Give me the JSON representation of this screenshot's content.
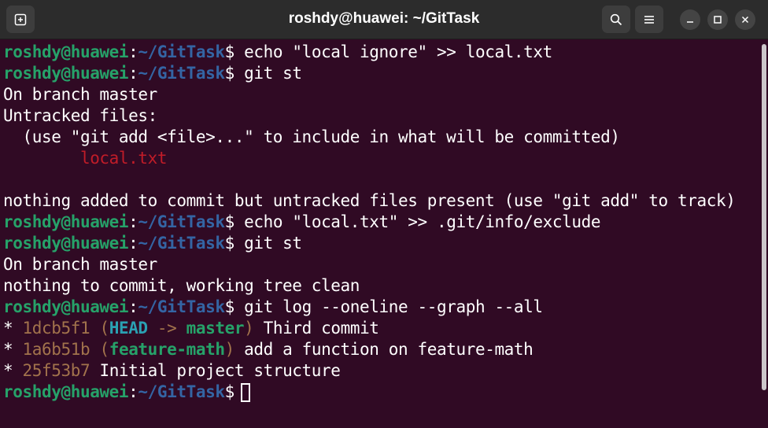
{
  "window": {
    "title": "roshdy@huawei: ~/GitTask"
  },
  "prompt": {
    "user_host": "roshdy@huawei",
    "colon": ":",
    "path": "~/GitTask",
    "symbol": "$"
  },
  "lines": {
    "cmd1": " echo \"local ignore\" >> local.txt",
    "cmd2": " git st",
    "out1": "On branch master",
    "out2": "Untracked files:",
    "out3": "  (use \"git add <file>...\" to include in what will be committed)",
    "out4_file": "        local.txt",
    "out5": "",
    "out6": "nothing added to commit but untracked files present (use \"git add\" to track)",
    "cmd3": " echo \"local.txt\" >> .git/info/exclude",
    "cmd4": " git st",
    "out7": "On branch master",
    "out8": "nothing to commit, working tree clean",
    "cmd5": " git log --oneline --graph --all"
  },
  "log": [
    {
      "star": "* ",
      "hash": "1dcb5f1",
      "open": " (",
      "head": "HEAD",
      "arrow": " -> ",
      "branch": "master",
      "close": ")",
      "msg": " Third commit"
    },
    {
      "star": "* ",
      "hash": "1a6b51b",
      "open": " (",
      "branch": "feature-math",
      "close": ")",
      "msg": " add a function on feature-math"
    },
    {
      "star": "* ",
      "hash": "25f53b7",
      "msg": " Initial project structure"
    }
  ],
  "colors": {
    "background": "#300a24",
    "user": "#26a269",
    "path": "#3465a4",
    "untracked": "#c01c28",
    "hash": "#a2734c",
    "head": "#2aa1b3"
  },
  "icons": [
    "new-tab-icon",
    "search-icon",
    "menu-icon",
    "minimize-icon",
    "maximize-icon",
    "close-icon"
  ]
}
